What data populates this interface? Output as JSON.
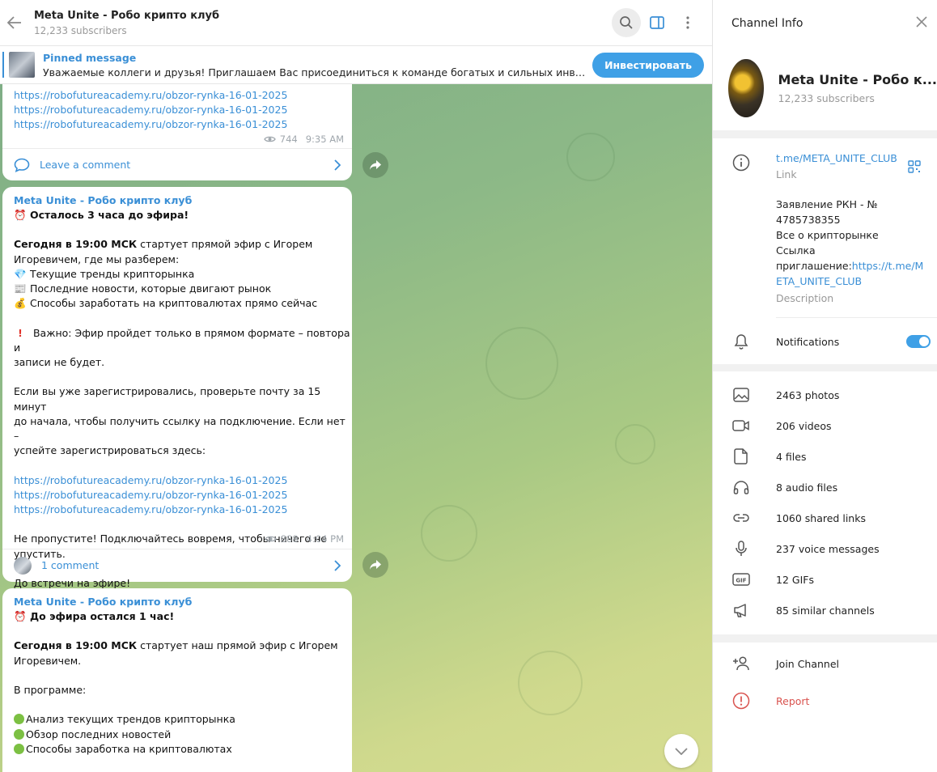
{
  "header": {
    "title": "Meta Unite - Робо крипто клуб",
    "subscribers": "12,233 subscribers"
  },
  "pinned": {
    "title": "Pinned message",
    "text": "Уважаемые коллеги и друзья!  Приглашаем Вас присоединиться к команде богатых и сильных инвесторов…",
    "button": "Инвестировать"
  },
  "messages": [
    {
      "links": [
        "https://robofutureacademy.ru/obzor-rynka-16-01-2025",
        "https://robofutureacademy.ru/obzor-rynka-16-01-2025",
        "https://robofutureacademy.ru/obzor-rynka-16-01-2025"
      ],
      "views": "744",
      "time": "9:35 AM",
      "comment_label": "Leave a comment"
    },
    {
      "author": "Meta Unite - Робо крипто клуб",
      "heading": "Осталось 3 часа до эфира!",
      "intro_bold": "Сегодня в 19:00 МСК",
      "intro_rest": " стартует прямой эфир с Игорем",
      "intro_line2": "Игоревичем, где мы разберем:",
      "bullets": [
        "Текущие тренды крипторынка",
        "Последние новости, которые двигают рынок",
        "Способы заработать на криптовалютах прямо сейчас"
      ],
      "important_line1": " Важно: Эфир пройдет только в прямом формате – повтора и",
      "important_line2": "записи не будет.",
      "reg_line1": "Если вы уже зарегистрировались, проверьте почту за 15 минут",
      "reg_line2": "до начала, чтобы получить ссылку на подключение. Если нет –",
      "reg_line3": "успейте зарегистрироваться здесь:",
      "links": [
        "https://robofutureacademy.ru/obzor-rynka-16-01-2025",
        "https://robofutureacademy.ru/obzor-rynka-16-01-2025",
        "https://robofutureacademy.ru/obzor-rynka-16-01-2025"
      ],
      "outro_line1": "Не пропустите! Подключайтесь вовремя, чтобы ничего не",
      "outro_line2": "упустить.",
      "closing": "До встречи на эфире!",
      "views": "888",
      "time": "4:04 PM",
      "comment_label": "1 comment"
    },
    {
      "author": "Meta Unite - Робо крипто клуб",
      "heading": "До эфира остался 1 час!",
      "intro_bold": "Сегодня в 19:00 МСК",
      "intro_rest": " стартует наш прямой эфир с Игорем",
      "intro_line2": "Игоревичем.",
      "program": "В программе:",
      "bullets": [
        "Анализ текущих трендов крипторынка",
        "Обзор последних новостей",
        "Способы заработка на криптовалютах"
      ]
    }
  ],
  "info": {
    "title": "Channel Info",
    "name": "Meta Unite - Робо к...",
    "subscribers": "12,233 subscribers",
    "link": "t.me/META_UNITE_CLUB",
    "link_caption": "Link",
    "desc_line1": "Заявление РКН - №",
    "desc_line2": "4785738355",
    "desc_line3": "Все о крипторынке",
    "desc_line4": "Ссылка",
    "desc_line5_plain": "приглашение:",
    "desc_line5_link": "https://t.me/M",
    "desc_line6_link": "ETA_UNITE_CLUB",
    "desc_caption": "Description",
    "notifications": "Notifications",
    "notifications_on": true,
    "media": [
      {
        "icon": "photo-icon",
        "label": "2463 photos"
      },
      {
        "icon": "video-icon",
        "label": "206 videos"
      },
      {
        "icon": "file-icon",
        "label": "4 files"
      },
      {
        "icon": "headphones-icon",
        "label": "8 audio files"
      },
      {
        "icon": "link-icon",
        "label": "1060 shared links"
      },
      {
        "icon": "microphone-icon",
        "label": "237 voice messages"
      },
      {
        "icon": "gif-icon",
        "label": "12 GIFs"
      },
      {
        "icon": "megaphone-icon",
        "label": "85 similar channels"
      }
    ],
    "join": "Join Channel",
    "report": "Report"
  },
  "colors": {
    "accent": "#3a8fd6",
    "button": "#3fa0e6",
    "report": "#d9534f"
  }
}
